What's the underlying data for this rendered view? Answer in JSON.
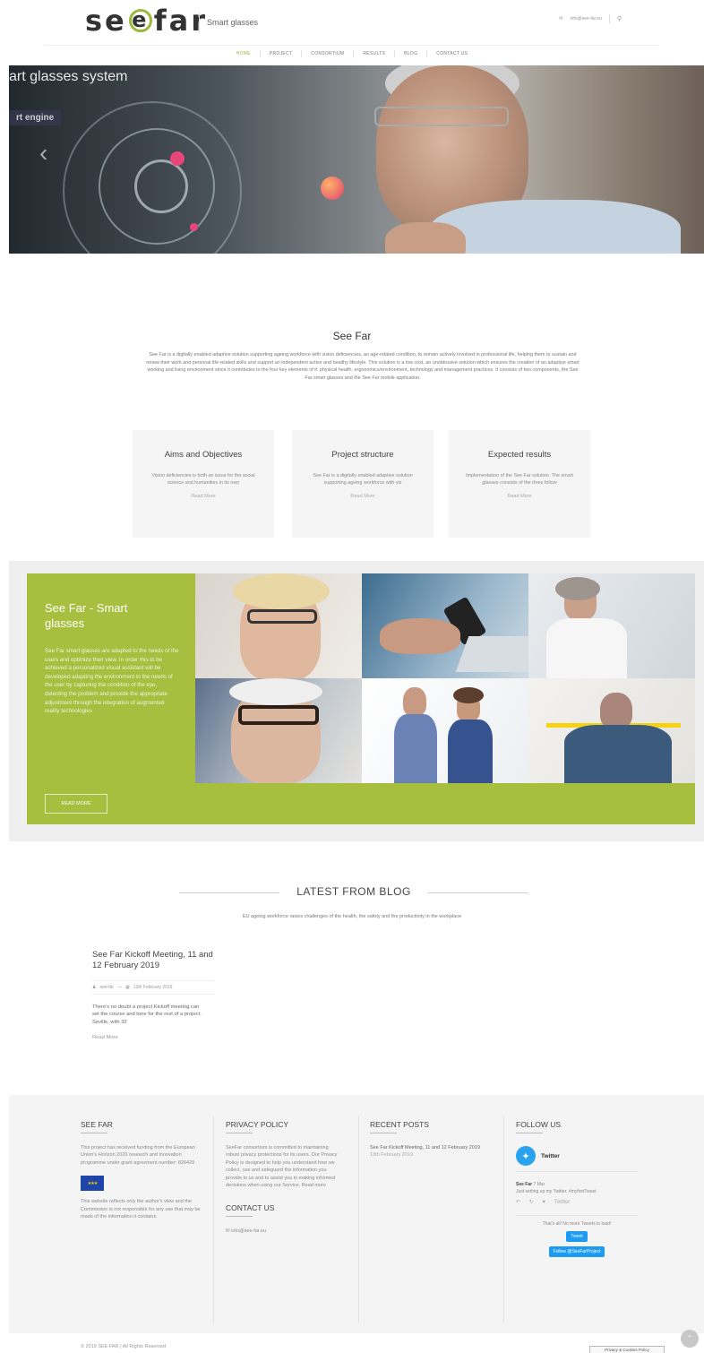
{
  "header": {
    "logo_text_left": "se",
    "logo_text_mid": "e",
    "logo_text_right": "far",
    "tagline": "Smart glasses",
    "email": "info@see-far.eu"
  },
  "nav": [
    "HOME",
    "PROJECT",
    "CONSORTIUM",
    "RESULTS",
    "BLOG",
    "CONTACT US"
  ],
  "hero": {
    "headline": "art glasses system",
    "sub": "rt engine",
    "prev_arrow": "‹"
  },
  "about": {
    "title": "See Far",
    "text": "See Far is a digitally enabled adaptive solution supporting ageing workforce with vision deficiencies, an age-related condition, to remain actively involved in professional life, helping them to sustain and renew their work and personal life-related skills and support an independent active and healthy lifestyle. This solution is a low cost, an unobtrusive solution which ensures the creation of an adaptive smart working and living environment since it contributes to the four key elements of it: physical health, ergonomics/environment, technology and management practices. It consists of two components, the See Far smart glasses and the See Far mobile application."
  },
  "boxes": [
    {
      "title": "Aims and Objectives",
      "text": "Vision deficiencies is both an issue for the social science and humanities in its own",
      "link": "Read More"
    },
    {
      "title": "Project structure",
      "text": "See Far is a digitally enabled adaptive solution supporting ageing workforce with vis",
      "link": "Read More"
    },
    {
      "title": "Expected results",
      "text": "Implementation of the See Far solution. The smart glasses consists of the three follow",
      "link": "Read More"
    }
  ],
  "smart_glasses": {
    "title": "See Far - Smart glasses",
    "text": "See Far smart glasses are adapted to the needs of the users and optimize their view. In order this to be achieved a personalized visual assistant will be developed adapting the environment to the needs of the user by capturing the condition of the eye, detecting the problem and provide the appropriate adjustment through the integration of augmented reality technologies",
    "button": "READ MORE"
  },
  "blog": {
    "title": "LATEST FROM BLOG",
    "subtitle": "EU ageing workforce raises challenges of the health, the safety and the productivity in the workplace",
    "post": {
      "title": "See Far Kickoff Meeting, 11 and 12 February 2019",
      "author": "see-far",
      "date": "13th February 2019",
      "excerpt": "There's no doubt a project Kickoff meeting can set the course and tone for the rest of a project. Seville, with 32",
      "link": "Read More"
    }
  },
  "footer": {
    "see_far": {
      "title": "SEE FAR",
      "text1": "This project has received funding from the European Union's Horizon 2020 research and innovation programme under grant agreement number: 826429",
      "text2": "This website reflects only the author's view and the Commission is not responsible for any use that may be made of the information it contains."
    },
    "privacy": {
      "title": "PRIVACY POLICY",
      "text": "SeeFar consortium is committed to maintaining robust privacy protections for its users. Our Privacy Policy is designed to help you understand how we collect, use and safeguard the information you provide to us and to assist you in making informed decisions when using our Service. Read more"
    },
    "contact": {
      "title": "CONTACT US",
      "email": "info@see-far.eu"
    },
    "recent": {
      "title": "RECENT POSTS",
      "post_title": "See Far Kickoff Meeting, 11 and 12 February 2019",
      "post_date": "13th February 2019"
    },
    "follow": {
      "title": "FOLLOW US",
      "twitter_label": "Twitter",
      "tweet_author": "See Far",
      "tweet_time": "7 Mar",
      "tweet_text": "Just setting up my Twitter. #myfirstTweet",
      "tweet_source": "Twitter",
      "end_text": "That's all! No more Tweets to load!",
      "tweet_button": "Tweet",
      "follow_button": "Follow @SeeFarProject"
    }
  },
  "copyright": "© 2019 SEE FAR | All Rights Reserved",
  "cookie_button": "Privacy & Cookies Policy"
}
